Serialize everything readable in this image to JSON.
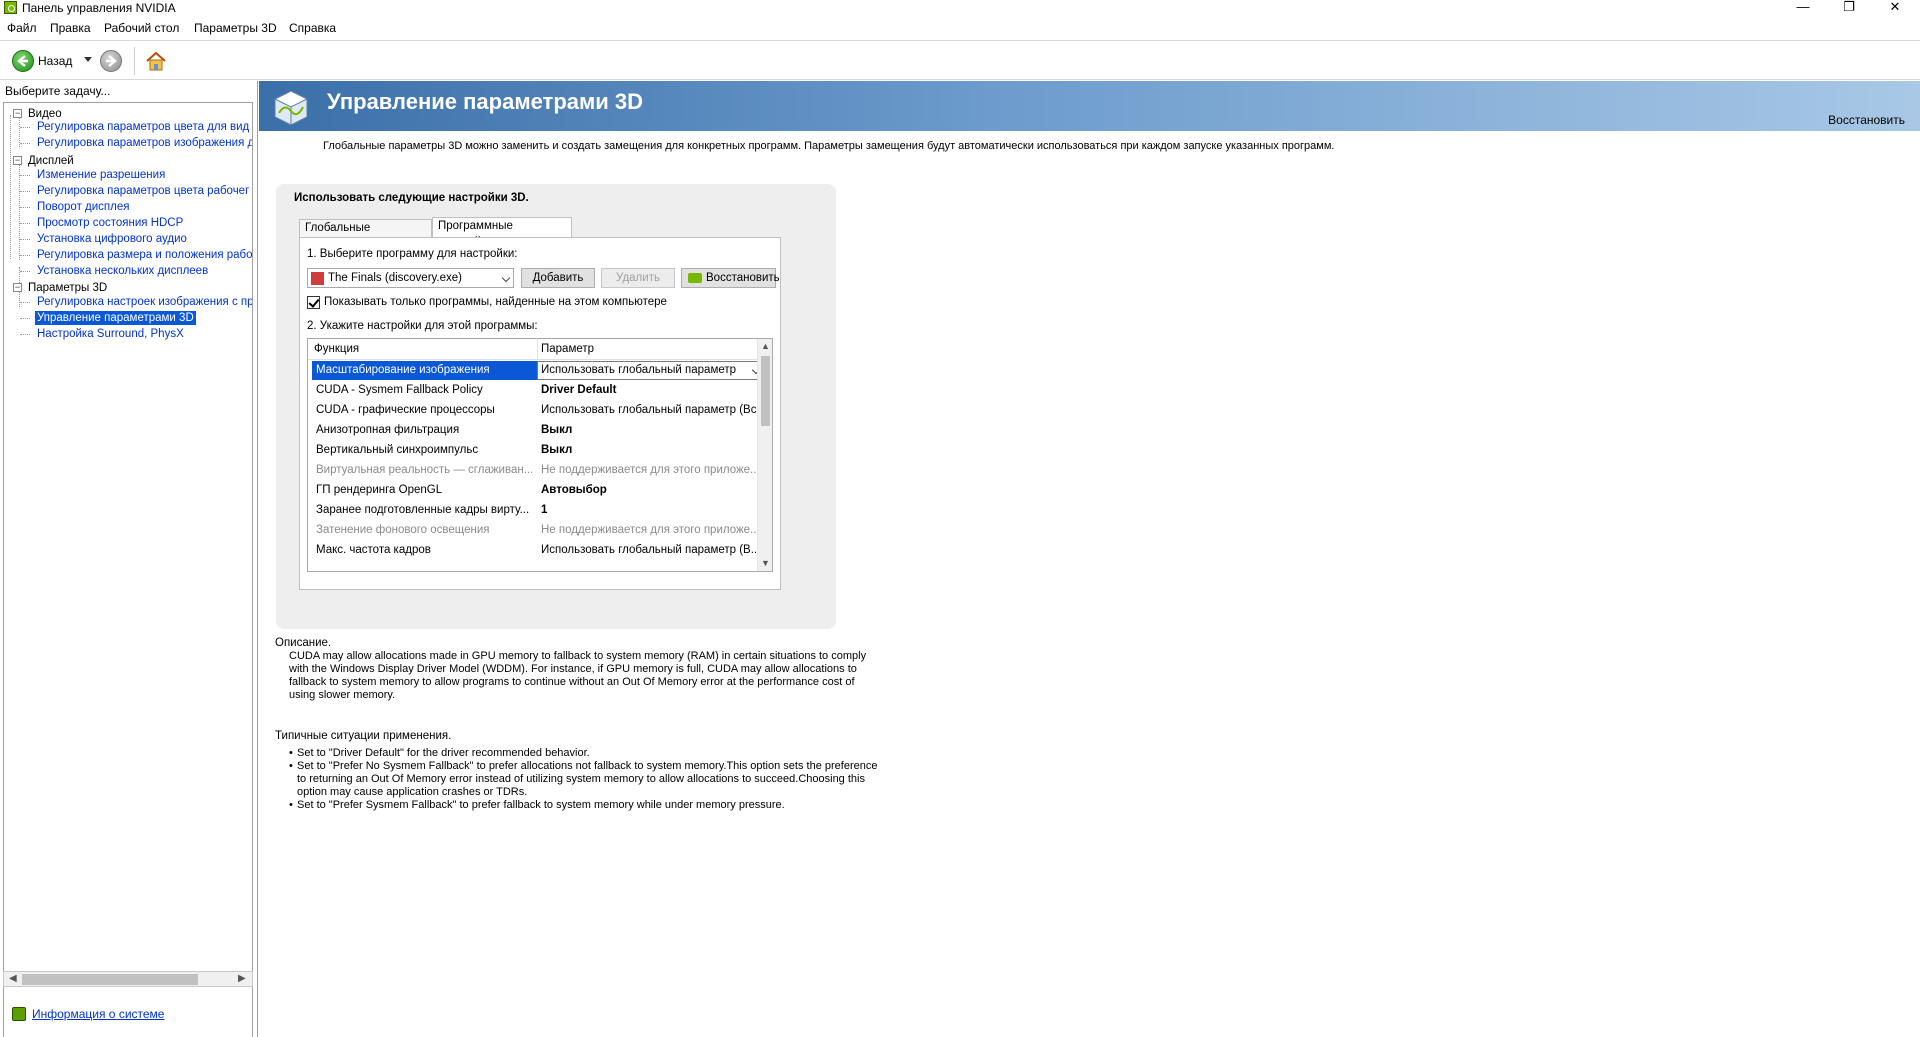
{
  "window": {
    "title": "Панель управления NVIDIA",
    "controls": {
      "minimize": "—",
      "maximize": "❐",
      "close": "✕"
    }
  },
  "menu": [
    "Файл",
    "Правка",
    "Рабочий стол",
    "Параметры 3D",
    "Справка"
  ],
  "toolbar": {
    "back_label": "Назад"
  },
  "sidebar": {
    "header": "Выберите задачу...",
    "categories": [
      {
        "label": "Видео",
        "items": [
          "Регулировка параметров цвета для вид",
          "Регулировка параметров изображения д"
        ]
      },
      {
        "label": "Дисплей",
        "items": [
          "Изменение разрешения",
          "Регулировка параметров цвета рабочег",
          "Поворот дисплея",
          "Просмотр состояния HDCP",
          "Установка цифрового аудио",
          "Регулировка размера и положения рабо",
          "Установка нескольких дисплеев"
        ]
      },
      {
        "label": "Параметры 3D",
        "items": [
          "Регулировка настроек изображения с пр",
          "Управление параметрами 3D",
          "Настройка Surround, PhysX"
        ]
      }
    ],
    "system_info": "Информация о системе"
  },
  "main": {
    "title": "Управление параметрами 3D",
    "restore": "Восстановить",
    "intro": "Глобальные параметры 3D можно заменить и создать замещения для конкретных программ. Параметры замещения будут автоматически использоваться при каждом запуске указанных программ.",
    "use_settings": "Использовать следующие настройки 3D.",
    "tabs": [
      "Глобальные параметры",
      "Программные настройки"
    ],
    "step1": "1. Выберите программу для настройки:",
    "program": "The Finals (discovery.exe)",
    "buttons": {
      "add": "Добавить",
      "remove": "Удалить",
      "restore": "Восстановить"
    },
    "show_only_label": "Показывать только программы, найденные на этом компьютере",
    "step2": "2. Укажите настройки для этой программы:",
    "grid": {
      "col_function": "Функция",
      "col_param": "Параметр",
      "rows": [
        {
          "f": "Масштабирование изображения",
          "p": "Использовать глобальный параметр"
        },
        {
          "f": "CUDA - Sysmem Fallback Policy",
          "p": "Driver Default"
        },
        {
          "f": "CUDA - графические процессоры",
          "p": "Использовать глобальный параметр (Все)"
        },
        {
          "f": "Анизотропная фильтрация",
          "p": "Выкл"
        },
        {
          "f": "Вертикальный синхроимпульс",
          "p": "Выкл"
        },
        {
          "f": "Виртуальная реальность — сглаживан...",
          "p": "Не поддерживается для этого приложе..."
        },
        {
          "f": "ГП рендеринга OpenGL",
          "p": "Автовыбор"
        },
        {
          "f": "Заранее подготовленные кадры вирту...",
          "p": "1"
        },
        {
          "f": "Затенение фонового освещения",
          "p": "Не поддерживается для этого приложе..."
        },
        {
          "f": "Макс. частота кадров",
          "p": "Использовать глобальный параметр (В..."
        }
      ]
    },
    "description_title": "Описание.",
    "description": "CUDA may allow allocations made in GPU memory to fallback to system memory (RAM) in certain situations to comply with the Windows Display Driver Model (WDDM). For instance, if GPU memory is full, CUDA may allow allocations to fallback to system memory to allow programs to continue without an Out Of Memory error at the performance cost of using slower memory.",
    "typical_title": "Типичные ситуации применения.",
    "typical": [
      "Set to \"Driver Default\" for the driver recommended behavior.",
      "Set to \"Prefer No Sysmem Fallback\" to prefer allocations not fallback to system memory.This option sets the preference to returning an Out Of Memory error instead of utilizing system memory to allow allocations to succeed.Choosing this option may cause application crashes or TDRs.",
      "Set to \"Prefer Sysmem Fallback\" to prefer fallback to system memory while under memory pressure."
    ]
  }
}
